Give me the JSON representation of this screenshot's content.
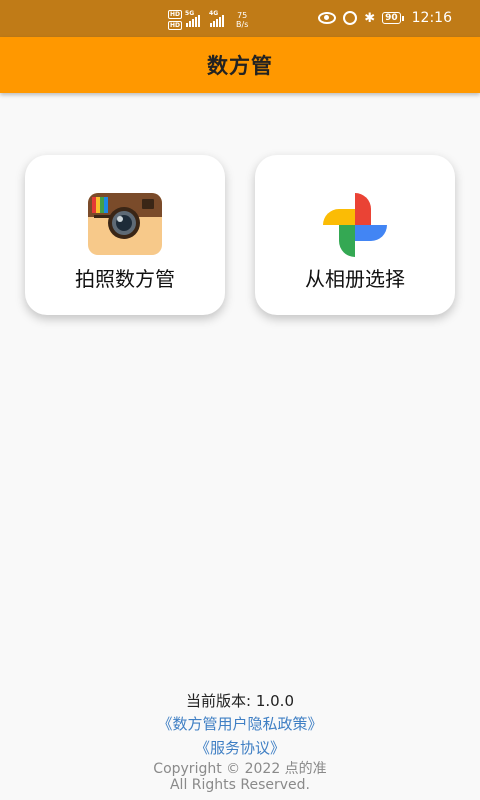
{
  "status_bar": {
    "hd_top": "HD",
    "hd_bottom": "HD",
    "sig1_tag": "5G",
    "sig2_tag": "4G",
    "speed_value": "75",
    "speed_unit": "B/s",
    "battery": "90",
    "time": "12:16"
  },
  "app_bar": {
    "title": "数方管"
  },
  "actions": {
    "camera": {
      "label": "拍照数方管",
      "icon": "camera-icon"
    },
    "gallery": {
      "label": "从相册选择",
      "icon": "photos-pinwheel-icon"
    }
  },
  "footer": {
    "version": "当前版本: 1.0.0",
    "privacy_link": "《数方管用户隐私政策》",
    "terms_link": "《服务协议》",
    "copyright_line1": "Copyright © 2022 点的准",
    "copyright_line2": "All Rights Reserved."
  },
  "colors": {
    "status_bar": "#c07b17",
    "app_bar": "#ff9800",
    "link": "#3f7fc4",
    "background": "#f9f9f9"
  }
}
